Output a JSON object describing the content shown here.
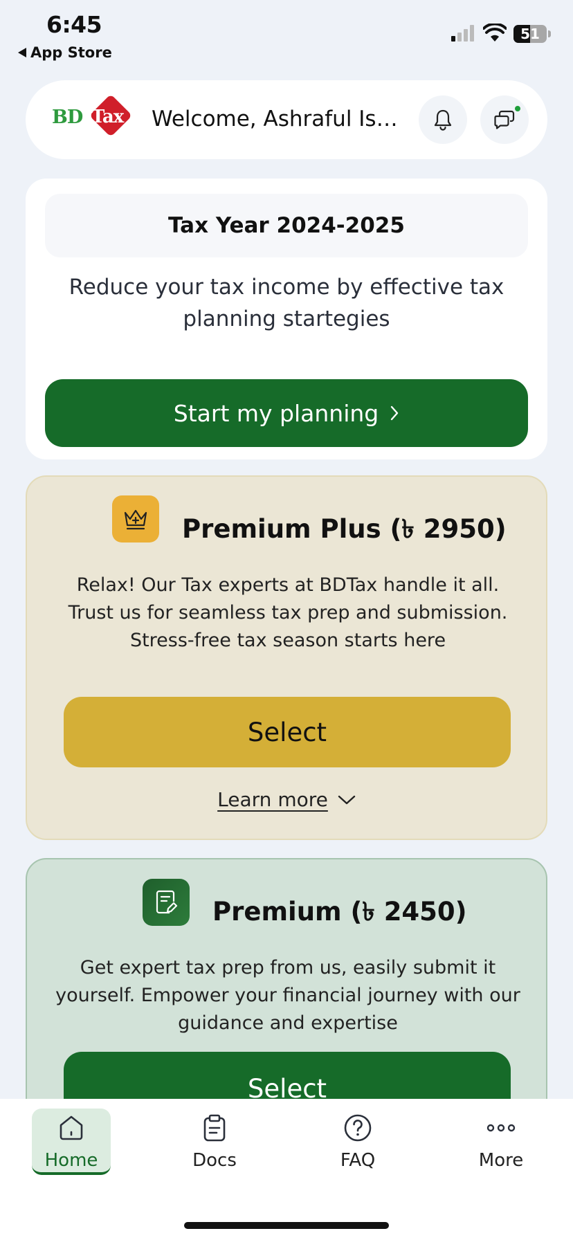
{
  "status_bar": {
    "time": "6:45",
    "back_label": "App Store",
    "battery_level": "51",
    "icons": [
      "back-arrow-icon",
      "cellular-signal-icon",
      "wifi-icon",
      "battery-icon"
    ]
  },
  "header": {
    "logo_text_bd": "BD",
    "logo_text_tax": "Tax",
    "welcome": "Welcome, Ashraful Isl...",
    "icons": [
      "bell-icon",
      "chat-icon"
    ],
    "has_unread_indicator": true
  },
  "planning_card": {
    "tax_year": "Tax Year 2024-2025",
    "description": "Reduce your tax income by effective tax planning startegies",
    "button_label": "Start my planning",
    "button_icon": "chevron-right-icon"
  },
  "premium_plus": {
    "icon": "crown-icon",
    "title": "Premium Plus (৳ 2950)",
    "description": "Relax! Our Tax experts at BDTax handle it all. Trust us for seamless tax prep and submission. Stress-free tax season starts here",
    "select_label": "Select",
    "learn_more_label": "Learn more",
    "learn_more_icon": "chevron-down-icon"
  },
  "premium": {
    "icon": "document-edit-icon",
    "title": "Premium (৳ 2450)",
    "description": "Get expert tax prep from us, easily submit it yourself. Empower your financial journey with our guidance and expertise",
    "select_label": "Select"
  },
  "tab_bar": {
    "tabs": [
      {
        "label": "Home",
        "icon": "home-icon",
        "active": true
      },
      {
        "label": "Docs",
        "icon": "clipboard-icon",
        "active": false
      },
      {
        "label": "FAQ",
        "icon": "question-circle-icon",
        "active": false
      },
      {
        "label": "More",
        "icon": "more-dots-icon",
        "active": false
      }
    ]
  },
  "colors": {
    "primary_green": "#166b29",
    "gold": "#d4af37",
    "brand_red": "#d01f2a",
    "brand_green": "#2e9a3e",
    "background": "#eef2f8"
  }
}
